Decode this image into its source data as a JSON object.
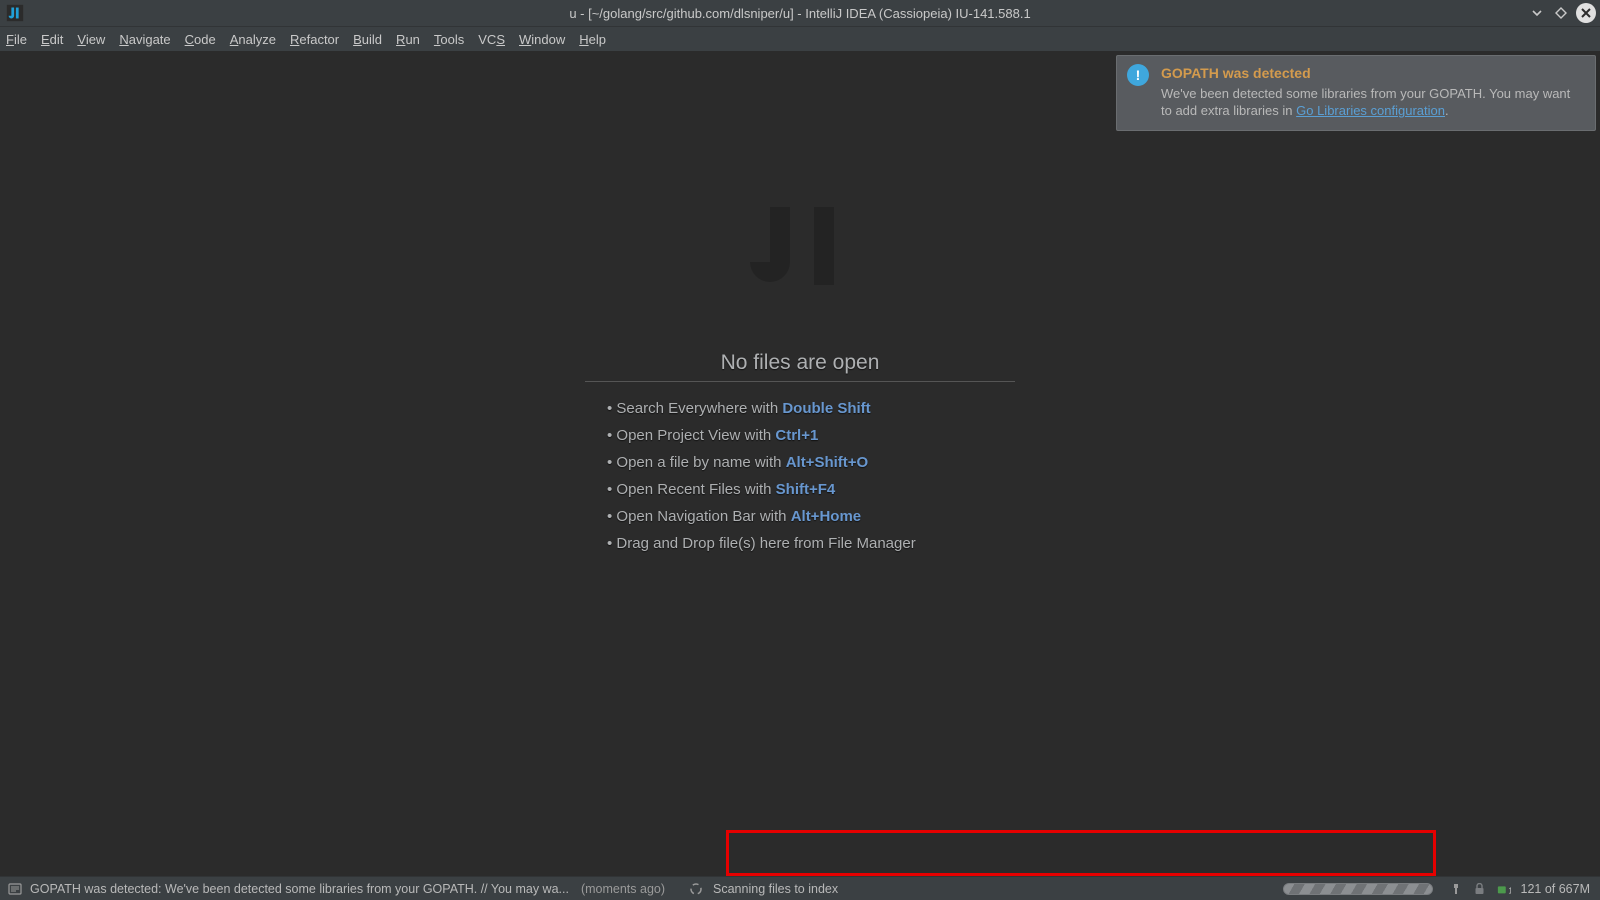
{
  "titlebar": {
    "title": "u - [~/golang/src/github.com/dlsniper/u] - IntelliJ IDEA (Cassiopeia) IU-141.588.1"
  },
  "menu": {
    "items": [
      "File",
      "Edit",
      "View",
      "Navigate",
      "Code",
      "Analyze",
      "Refactor",
      "Build",
      "Run",
      "Tools",
      "VCS",
      "Window",
      "Help"
    ]
  },
  "notification": {
    "title": "GOPATH was detected",
    "body_pre": "We've been detected some libraries from your GOPATH. You may want to add extra libraries in ",
    "link": "Go Libraries configuration",
    "body_post": "."
  },
  "welcome": {
    "heading": "No files are open",
    "tips": [
      {
        "text": "Search Everywhere with ",
        "shortcut": "Double Shift"
      },
      {
        "text": "Open Project View with ",
        "shortcut": "Ctrl+1"
      },
      {
        "text": "Open a file by name with ",
        "shortcut": "Alt+Shift+O"
      },
      {
        "text": "Open Recent Files with ",
        "shortcut": "Shift+F4"
      },
      {
        "text": "Open Navigation Bar with ",
        "shortcut": "Alt+Home"
      },
      {
        "text": "Drag and Drop file(s) here from File Manager",
        "shortcut": ""
      }
    ]
  },
  "status": {
    "message": "GOPATH was detected: We've been detected some libraries from your GOPATH. // You may wa...",
    "time": "(moments ago)",
    "task": "Scanning files to index",
    "memory": "121 of 667M"
  }
}
